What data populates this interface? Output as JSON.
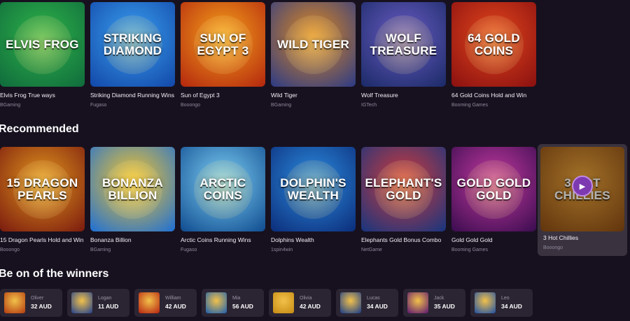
{
  "top_row": [
    {
      "title": "Elvis Frog True ways",
      "provider": "BGaming",
      "art": "ELVIS FROG",
      "colors": [
        "#0f6b3c",
        "#2fb34a"
      ]
    },
    {
      "title": "Striking Diamond Running Wins",
      "provider": "Fugaso",
      "art": "STRIKING DIAMOND",
      "colors": [
        "#1247a8",
        "#3aa0f0"
      ]
    },
    {
      "title": "Sun of Egypt 3",
      "provider": "Booongo",
      "art": "SUN OF EGYPT 3",
      "colors": [
        "#b3260e",
        "#f5a21b"
      ]
    },
    {
      "title": "Wild Tiger",
      "provider": "BGaming",
      "art": "WILD TIGER",
      "colors": [
        "#2b3a86",
        "#e18a1f"
      ]
    },
    {
      "title": "Wolf Treasure",
      "provider": "IGTech",
      "art": "WOLF TREASURE",
      "colors": [
        "#1a2a66",
        "#6a5cc4"
      ]
    },
    {
      "title": "64 Gold Coins Hold and Win",
      "provider": "Booming Games",
      "art": "64 GOLD COINS",
      "colors": [
        "#8a1010",
        "#e2461c"
      ]
    }
  ],
  "recommended": {
    "heading": "Recommended",
    "games": [
      {
        "title": "15 Dragon Pearls Hold and Win",
        "provider": "Booongo",
        "art": "15 DRAGON PEARLS",
        "colors": [
          "#7a1a0e",
          "#e2961e"
        ]
      },
      {
        "title": "Bonanza Billion",
        "provider": "BGaming",
        "art": "BONANZA BILLION",
        "colors": [
          "#1d6fd6",
          "#f7c62a"
        ]
      },
      {
        "title": "Arctic Coins Running Wins",
        "provider": "Fugaso",
        "art": "ARCTIC COINS",
        "colors": [
          "#0f4b8f",
          "#7ed0f5"
        ]
      },
      {
        "title": "Dolphins Wealth",
        "provider": "1spin4win",
        "art": "DOLPHIN'S WEALTH",
        "colors": [
          "#0b2d7a",
          "#2d8de0"
        ]
      },
      {
        "title": "Elephants Gold Bonus Combo",
        "provider": "NetGame",
        "art": "ELEPHANT'S GOLD",
        "colors": [
          "#16357f",
          "#d23a3a"
        ]
      },
      {
        "title": "Gold Gold Gold",
        "provider": "Booming Games",
        "art": "GOLD GOLD GOLD",
        "colors": [
          "#3a0c4f",
          "#c43aa0"
        ]
      }
    ],
    "hover_game": {
      "title": "3 Hot Chillies",
      "provider": "Booongo",
      "art": "3 HOT CHILLIES",
      "play_icon": "play-icon",
      "colors": [
        "#8a4a12",
        "#e9a33a"
      ]
    }
  },
  "winners": {
    "heading": "Be on of the winners",
    "entries": [
      {
        "name": "Oliver",
        "amount": "32 AUD",
        "color": "#b3390f"
      },
      {
        "name": "Logan",
        "amount": "11 AUD",
        "color": "#1f3f8f"
      },
      {
        "name": "William",
        "amount": "42 AUD",
        "color": "#b5200f"
      },
      {
        "name": "Mia",
        "amount": "56 AUD",
        "color": "#1a5fb0"
      },
      {
        "name": "Olivia",
        "amount": "42 AUD",
        "color": "#c58a12"
      },
      {
        "name": "Lucas",
        "amount": "34 AUD",
        "color": "#173a8a"
      },
      {
        "name": "Jack",
        "amount": "35 AUD",
        "color": "#5b1470"
      },
      {
        "name": "Leo",
        "amount": "34 AUD",
        "color": "#1c4fa8"
      }
    ]
  }
}
